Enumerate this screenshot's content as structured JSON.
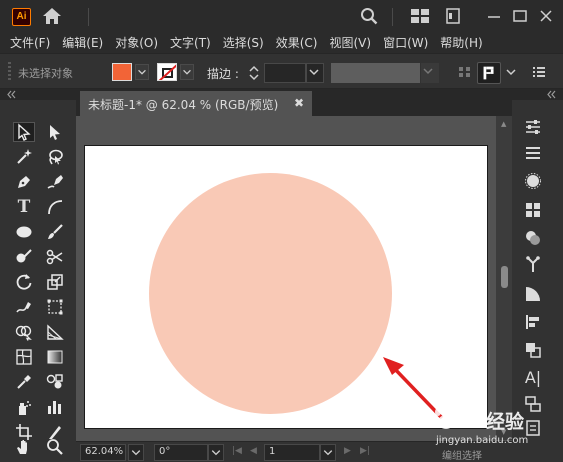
{
  "app": {
    "logo_text": "Ai",
    "accent_color": "#ff7c00"
  },
  "icons": [
    "home-icon",
    "search-icon",
    "workspace-layout-icon",
    "document-icon",
    "minimize-icon",
    "maximize-icon",
    "close-icon"
  ],
  "menu": {
    "items": [
      "文件(F)",
      "编辑(E)",
      "对象(O)",
      "文字(T)",
      "选择(S)",
      "效果(C)",
      "视图(V)",
      "窗口(W)",
      "帮助(H)"
    ]
  },
  "control_bar": {
    "selection_status": "未选择对象",
    "fill_color": "#f26437",
    "stroke_color": "none",
    "stroke_label": "描边",
    "stroke_width": ""
  },
  "document": {
    "tab_title": "未标题-1* @ 62.04 % (RGB/预览)",
    "tab_close": "✖",
    "artboard_color": "#ffffff",
    "shape": {
      "type": "ellipse",
      "fill_color": "#f9c9b6"
    }
  },
  "status_bar": {
    "zoom": "62.04%",
    "rotation": "0°",
    "page": "1",
    "status": "编组选择"
  },
  "annotation": {
    "arrow_color": "#e02020"
  },
  "watermark": {
    "brand": "经验",
    "url": "jingyan.baidu.com"
  }
}
